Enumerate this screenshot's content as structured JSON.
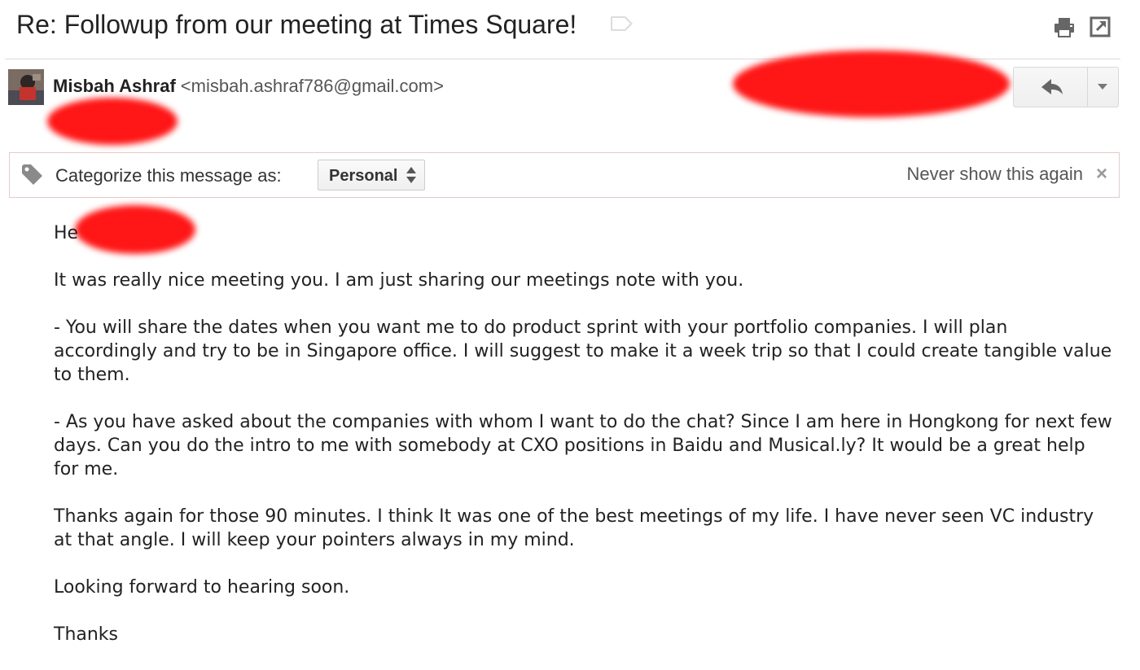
{
  "email": {
    "subject": "Re: Followup from our meeting at Times Square!",
    "sender": {
      "name": "Misbah Ashraf",
      "email": "<misbah.ashraf786@gmail.com>"
    }
  },
  "toolbar": {
    "print_icon": "print-icon",
    "popout_icon": "new-window-icon",
    "reply_icon": "reply-icon",
    "more_icon": "chevron-down-icon"
  },
  "categorize": {
    "label": "Categorize this message as:",
    "selected": "Personal",
    "dismiss": "Never show this again",
    "close": "×"
  },
  "body": {
    "greeting": "He",
    "paragraphs": [
      "It was really nice meeting you. I am just sharing our meetings note with you.",
      "- You will share the dates when you want me to do product sprint with your portfolio companies. I will plan accordingly and try to be in Singapore office. I will suggest to make it a week trip so that I could create tangible value to them.",
      "- As you have asked about the companies with whom I want to do the chat? Since I am here in Hongkong for next few days. Can you do the intro to me with somebody at CXO positions in Baidu and Musical.ly? It would be a great help for me.",
      "Thanks again for those 90 minutes. I think It was one of the best meetings of my life. I have never seen VC industry at that angle. I will keep your pointers always in my mind.",
      "Looking forward to hearing soon.",
      "Thanks"
    ]
  },
  "colors": {
    "redaction": "#ff1616",
    "border": "#dcdcdc",
    "text": "#222222"
  }
}
